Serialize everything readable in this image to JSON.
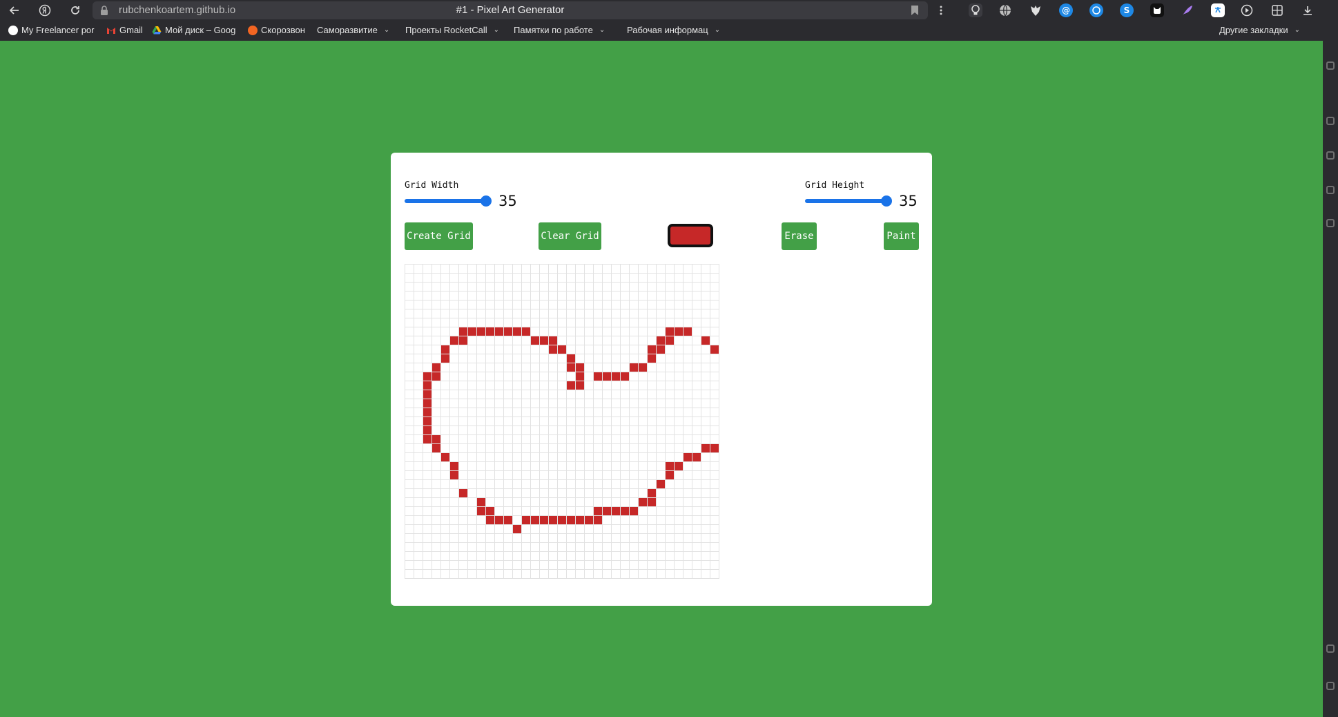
{
  "browser": {
    "url": "rubchenkoartem.github.io",
    "tab_title": "#1 - Pixel Art Generator",
    "bookmarks": [
      {
        "label": "My Freelancer por",
        "icon": "circle-icon",
        "color": "#ffffff",
        "menu": false
      },
      {
        "label": "Gmail",
        "icon": "gmail-icon",
        "color": "#ea4335",
        "menu": false
      },
      {
        "label": "Мой диск – Goog",
        "icon": "drive-icon",
        "color": "#fbbc04",
        "menu": false
      },
      {
        "label": "Скорозвон",
        "icon": "skorozvon-icon",
        "color": "#f26522",
        "menu": false
      },
      {
        "label": "Саморазвитие",
        "icon": "",
        "color": "",
        "menu": true
      },
      {
        "label": "Проекты RocketCall",
        "icon": "",
        "color": "",
        "menu": true
      },
      {
        "label": "Памятки по работе",
        "icon": "",
        "color": "",
        "menu": true
      },
      {
        "label": "Рабочая информац",
        "icon": "",
        "color": "",
        "menu": true
      }
    ],
    "other_bookmarks": "Другие закладки"
  },
  "app": {
    "width_label": "Grid Width",
    "width_value": "35",
    "width_level": 1.0,
    "height_label": "Grid Height",
    "height_value": "35",
    "height_level": 1.0,
    "create_button": "Create Grid",
    "clear_button": "Clear Grid",
    "erase_button": "Erase",
    "paint_button": "Paint",
    "paint_color": "#c62828",
    "accent_color": "#43a047",
    "slider_color": "#1a73e8",
    "grid": {
      "columns": 35,
      "rows": 35,
      "painted": [
        [
          7,
          6
        ],
        [
          7,
          7
        ],
        [
          7,
          8
        ],
        [
          7,
          9
        ],
        [
          7,
          10
        ],
        [
          7,
          11
        ],
        [
          7,
          12
        ],
        [
          7,
          13
        ],
        [
          7,
          29
        ],
        [
          7,
          30
        ],
        [
          7,
          31
        ],
        [
          8,
          5
        ],
        [
          8,
          6
        ],
        [
          8,
          14
        ],
        [
          8,
          15
        ],
        [
          8,
          16
        ],
        [
          8,
          28
        ],
        [
          8,
          29
        ],
        [
          8,
          33
        ],
        [
          9,
          4
        ],
        [
          9,
          16
        ],
        [
          9,
          17
        ],
        [
          9,
          27
        ],
        [
          9,
          28
        ],
        [
          9,
          34
        ],
        [
          10,
          4
        ],
        [
          10,
          18
        ],
        [
          10,
          27
        ],
        [
          11,
          3
        ],
        [
          11,
          18
        ],
        [
          11,
          19
        ],
        [
          11,
          25
        ],
        [
          11,
          26
        ],
        [
          12,
          2
        ],
        [
          12,
          3
        ],
        [
          12,
          19
        ],
        [
          12,
          21
        ],
        [
          12,
          22
        ],
        [
          12,
          23
        ],
        [
          12,
          24
        ],
        [
          13,
          2
        ],
        [
          13,
          18
        ],
        [
          13,
          19
        ],
        [
          14,
          2
        ],
        [
          15,
          2
        ],
        [
          16,
          2
        ],
        [
          17,
          2
        ],
        [
          18,
          2
        ],
        [
          19,
          2
        ],
        [
          19,
          3
        ],
        [
          20,
          3
        ],
        [
          20,
          33
        ],
        [
          20,
          34
        ],
        [
          21,
          4
        ],
        [
          21,
          31
        ],
        [
          21,
          32
        ],
        [
          22,
          5
        ],
        [
          22,
          29
        ],
        [
          22,
          30
        ],
        [
          23,
          5
        ],
        [
          23,
          29
        ],
        [
          24,
          28
        ],
        [
          25,
          6
        ],
        [
          25,
          27
        ],
        [
          26,
          8
        ],
        [
          26,
          26
        ],
        [
          26,
          27
        ],
        [
          27,
          8
        ],
        [
          27,
          9
        ],
        [
          27,
          21
        ],
        [
          27,
          22
        ],
        [
          27,
          23
        ],
        [
          27,
          24
        ],
        [
          27,
          25
        ],
        [
          28,
          9
        ],
        [
          28,
          10
        ],
        [
          28,
          11
        ],
        [
          28,
          13
        ],
        [
          28,
          14
        ],
        [
          28,
          15
        ],
        [
          28,
          16
        ],
        [
          28,
          17
        ],
        [
          28,
          18
        ],
        [
          28,
          19
        ],
        [
          28,
          20
        ],
        [
          28,
          21
        ],
        [
          29,
          12
        ]
      ]
    }
  }
}
